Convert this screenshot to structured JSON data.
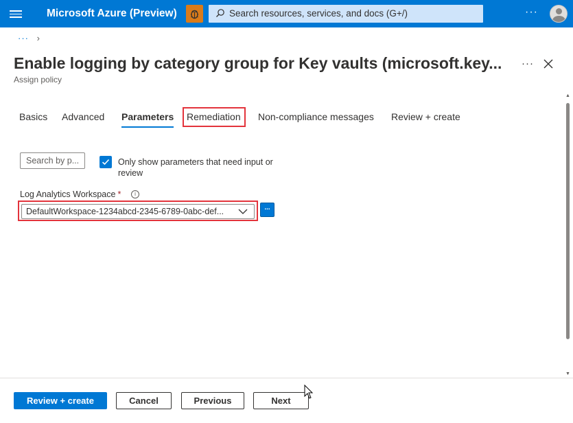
{
  "app": {
    "title": "Microsoft Azure (Preview)",
    "search_placeholder": "Search resources, services, and docs (G+/)",
    "more_label": "···"
  },
  "breadcrumb": {
    "dots": "···",
    "chevron": "›"
  },
  "page": {
    "title": "Enable logging by category group for Key vaults (microsoft.key...",
    "subtitle": "Assign policy",
    "more_label": "···"
  },
  "tabs": [
    {
      "label": "Basics",
      "active": false
    },
    {
      "label": "Advanced",
      "active": false
    },
    {
      "label": "Parameters",
      "active": true
    },
    {
      "label": "Remediation",
      "active": false,
      "highlighted": true
    },
    {
      "label": "Non-compliance messages",
      "active": false
    },
    {
      "label": "Review + create",
      "active": false
    }
  ],
  "filters": {
    "search_placeholder": "Search by p...",
    "only_required_checked": true,
    "only_required_label": "Only show parameters that need input or review"
  },
  "parameters": {
    "workspace_label": "Log Analytics Workspace",
    "required_mark": "*",
    "info_glyph": "i",
    "workspace_value": "DefaultWorkspace-1234abcd-2345-6789-0abc-def...",
    "browse_label": "..."
  },
  "footer": {
    "review_create": "Review + create",
    "cancel": "Cancel",
    "previous": "Previous",
    "next": "Next"
  },
  "colors": {
    "accent": "#0078d4",
    "highlight": "#e3333b",
    "bug_button": "#d97b1a"
  }
}
